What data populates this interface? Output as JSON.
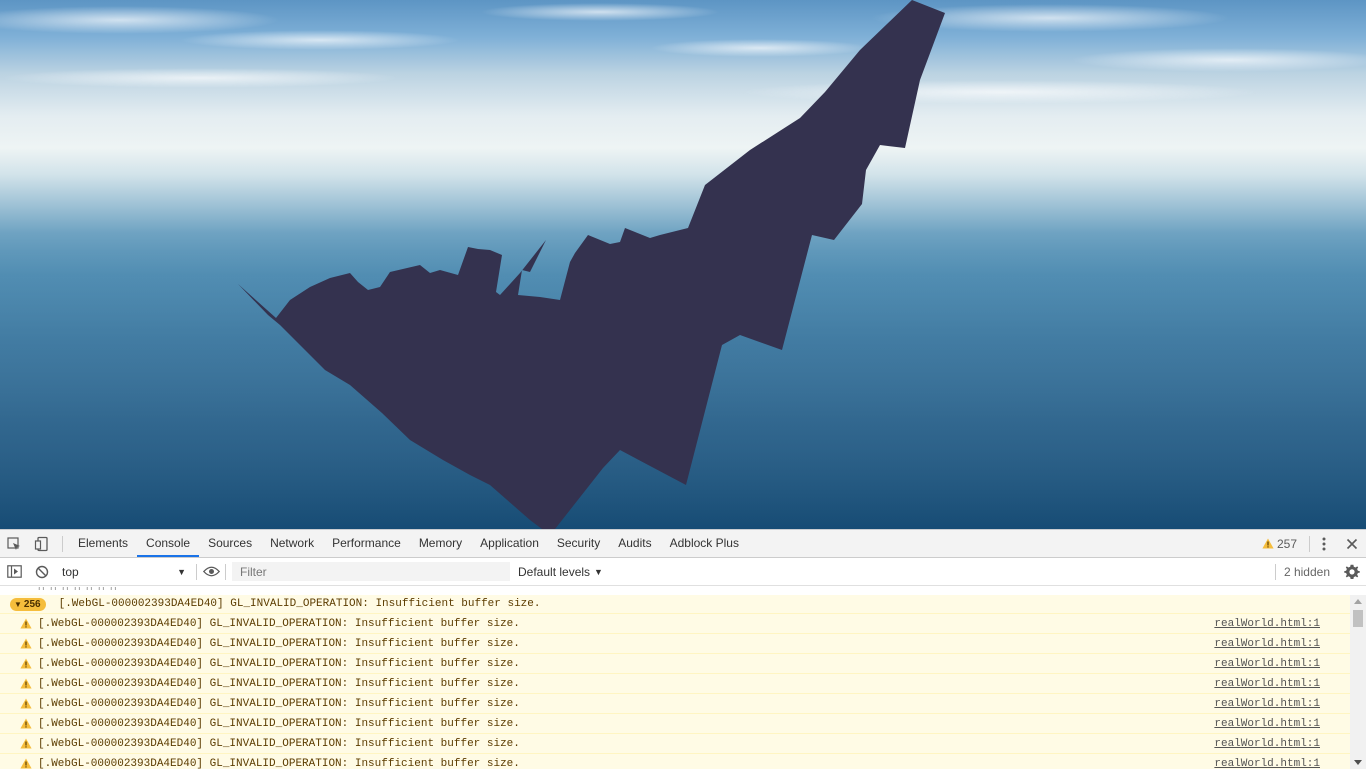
{
  "devtools": {
    "tabs": [
      {
        "label": "Elements"
      },
      {
        "label": "Console",
        "selected": true
      },
      {
        "label": "Sources"
      },
      {
        "label": "Network"
      },
      {
        "label": "Performance"
      },
      {
        "label": "Memory"
      },
      {
        "label": "Application"
      },
      {
        "label": "Security"
      },
      {
        "label": "Audits"
      },
      {
        "label": "Adblock Plus"
      }
    ],
    "warning_count": "257",
    "context": "top",
    "filter_placeholder": "Filter",
    "levels": "Default levels",
    "hidden_count": "2 hidden",
    "accent_color": "#1a73e8",
    "warning_color": "#f5bd3c",
    "icons": [
      "inspect-element-icon",
      "device-toolbar-icon",
      "warning-icon",
      "kebab-menu-icon",
      "close-icon",
      "sidebar-toggle-icon",
      "clear-console-icon",
      "eye-icon",
      "gear-icon"
    ]
  },
  "console": {
    "group": {
      "count": "256",
      "message": "[.WebGL-000002393DA4ED40] GL_INVALID_OPERATION: Insufficient buffer size."
    },
    "messages": [
      {
        "text": "[.WebGL-000002393DA4ED40] GL_INVALID_OPERATION: Insufficient buffer size.",
        "source": "realWorld.html:1"
      },
      {
        "text": "[.WebGL-000002393DA4ED40] GL_INVALID_OPERATION: Insufficient buffer size.",
        "source": "realWorld.html:1"
      },
      {
        "text": "[.WebGL-000002393DA4ED40] GL_INVALID_OPERATION: Insufficient buffer size.",
        "source": "realWorld.html:1"
      },
      {
        "text": "[.WebGL-000002393DA4ED40] GL_INVALID_OPERATION: Insufficient buffer size.",
        "source": "realWorld.html:1"
      },
      {
        "text": "[.WebGL-000002393DA4ED40] GL_INVALID_OPERATION: Insufficient buffer size.",
        "source": "realWorld.html:1"
      },
      {
        "text": "[.WebGL-000002393DA4ED40] GL_INVALID_OPERATION: Insufficient buffer size.",
        "source": "realWorld.html:1"
      },
      {
        "text": "[.WebGL-000002393DA4ED40] GL_INVALID_OPERATION: Insufficient buffer size.",
        "source": "realWorld.html:1"
      },
      {
        "text": "[.WebGL-000002393DA4ED40] GL_INVALID_OPERATION: Insufficient buffer size.",
        "source": "realWorld.html:1"
      }
    ]
  }
}
